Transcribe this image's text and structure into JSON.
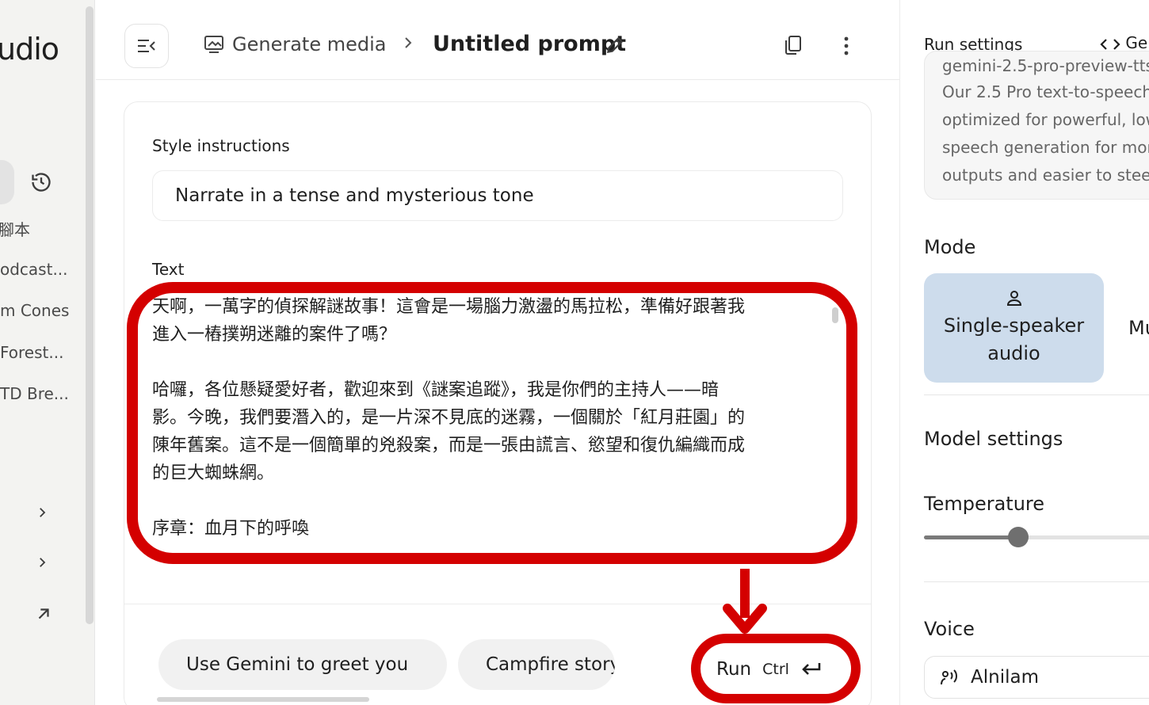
{
  "sidebar": {
    "brand": "udio",
    "items": [
      "腳本",
      "odcast...",
      "m Cones",
      " Forest...",
      "TD Bre..."
    ]
  },
  "header": {
    "breadcrumb": "Generate media",
    "title": "Untitled prompt"
  },
  "main": {
    "style_label": "Style instructions",
    "style_value": "Narrate in a tense and mysterious tone",
    "text_label": "Text",
    "text_lines": [
      "天啊，一萬字的偵探解謎故事！這會是一場腦力激盪的馬拉松，準備好跟著我",
      "進入一樁撲朔迷離的案件了嗎？",
      "",
      "哈囉，各位懸疑愛好者，歡迎來到《謎案追蹤》，我是你們的主持人——暗",
      "影。今晚，我們要潛入的，是一片深不見底的迷霧，一個關於「紅月莊園」的",
      "陳年舊案。這不是一個簡單的兇殺案，而是一張由謊言、慾望和復仇編織而成",
      "的巨大蜘蛛網。",
      "",
      "序章：血月下的呼喚"
    ],
    "chips": [
      "Use Gemini to greet you",
      "Campfire story"
    ],
    "run_label": "Run",
    "run_shortcut": "Ctrl"
  },
  "right_panel": {
    "title": "Run settings",
    "code_label": "Ge",
    "model_id": "gemini-2.5-pro-preview-tts",
    "model_desc_lines": [
      "Our 2.5 Pro text-to-speech",
      "optimized for powerful, low",
      "speech generation for more",
      "outputs and easier to steer"
    ],
    "mode_heading": "Mode",
    "mode_single": "Single-speaker audio",
    "mode_multi": "Mu",
    "model_settings_heading": "Model settings",
    "temperature_label": "Temperature",
    "temperature_fraction": 0.41,
    "voice_label": "Voice",
    "voice_value": "Alnilam"
  },
  "colors": {
    "annotation": "#d40000",
    "mode_selected": "#cddcec"
  }
}
